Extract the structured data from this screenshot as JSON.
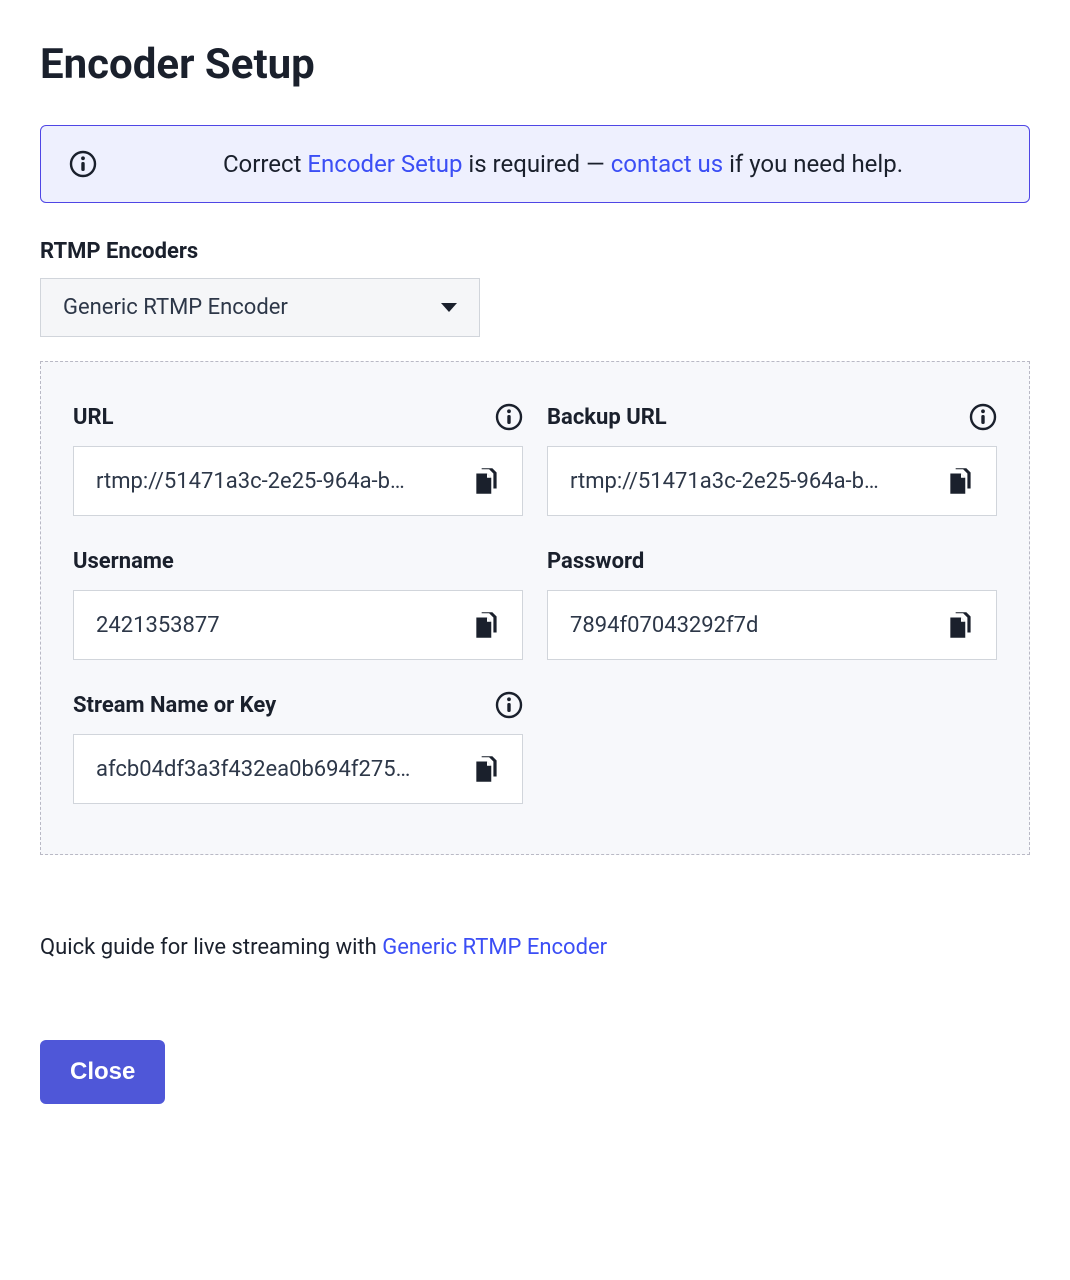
{
  "title": "Encoder Setup",
  "alert": {
    "prefix": "Correct ",
    "link1": "Encoder Setup",
    "middle": " is required — ",
    "link2": "contact us",
    "suffix": " if you need help."
  },
  "encoder_select": {
    "label": "RTMP Encoders",
    "value": "Generic RTMP Encoder"
  },
  "fields": {
    "url": {
      "label": "URL",
      "value": "rtmp://51471a3c-2e25-964a-b…",
      "has_info": true
    },
    "backup_url": {
      "label": "Backup URL",
      "value": "rtmp://51471a3c-2e25-964a-b…",
      "has_info": true
    },
    "username": {
      "label": "Username",
      "value": "2421353877",
      "has_info": false
    },
    "password": {
      "label": "Password",
      "value": "7894f07043292f7d",
      "has_info": false
    },
    "stream_key": {
      "label": "Stream Name or Key",
      "value": "afcb04df3a3f432ea0b694f275…",
      "has_info": true
    }
  },
  "guide": {
    "prefix": "Quick guide for live streaming with ",
    "link": "Generic RTMP Encoder"
  },
  "close_label": "Close"
}
